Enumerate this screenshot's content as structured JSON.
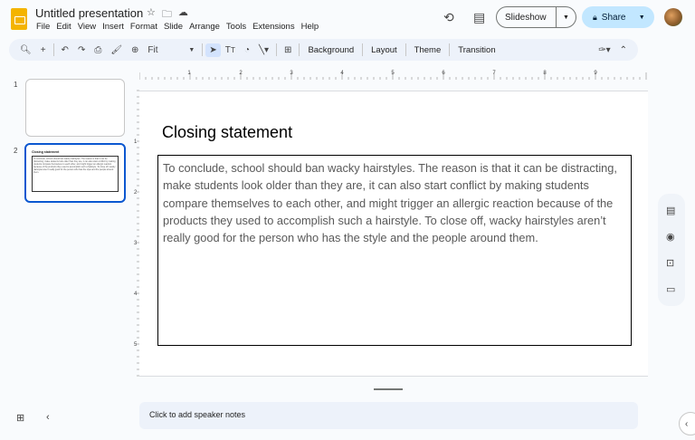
{
  "app": {
    "title": "Untitled presentation",
    "title_icons": [
      "star-icon",
      "move-folder-icon",
      "cloud-status-icon"
    ],
    "menu": [
      "File",
      "Edit",
      "View",
      "Insert",
      "Format",
      "Slide",
      "Arrange",
      "Tools",
      "Extensions",
      "Help"
    ]
  },
  "header_actions": {
    "slideshow_label": "Slideshow",
    "share_label": "Share",
    "icons": [
      "history-icon",
      "comments-icon",
      "lock-icon",
      "avatar"
    ]
  },
  "toolbar": {
    "zoom_label": "Fit",
    "background_label": "Background",
    "layout_label": "Layout",
    "theme_label": "Theme",
    "transition_label": "Transition"
  },
  "ruler": {
    "horizontal_labels": [
      "1",
      "2",
      "3",
      "4",
      "5",
      "6",
      "7",
      "8",
      "9"
    ],
    "vertical_labels": [
      "1",
      "2",
      "3",
      "4",
      "5"
    ]
  },
  "filmstrip": {
    "slides": [
      {
        "number": "1",
        "title": "",
        "body": ""
      },
      {
        "number": "2",
        "title": "Closing statement",
        "body": "To conclude, school should ban wacky hairstyles. The reason is that it can be distracting, make students look older than they are, it can also start conflict by making students compare themselves to each other, and might trigger an allergic reaction because of the products they used to accomplish such a hairstyle. To close off, wacky  hairstyles aren’t really good for the person who has the style and the people around them."
      }
    ]
  },
  "slide": {
    "title": "Closing statement",
    "body": "To conclude, school should ban wacky hairstyles. The reason is that it can be distracting, make students look older than they are, it can also start conflict by making students compare themselves to each other, and might trigger an allergic reaction because of the products they used to accomplish such a hairstyle. To close off, wacky  hairstyles aren’t really good for the person who has the style and the people around them."
  },
  "notes": {
    "placeholder": "Click to add speaker notes"
  },
  "side_panel": {
    "icons": [
      "keep-icon",
      "tasks-icon",
      "contacts-icon",
      "maps-icon"
    ]
  },
  "colors": {
    "accent": "#0b57d0",
    "share_bg": "#c2e7ff",
    "app_logo": "#f4b400"
  }
}
